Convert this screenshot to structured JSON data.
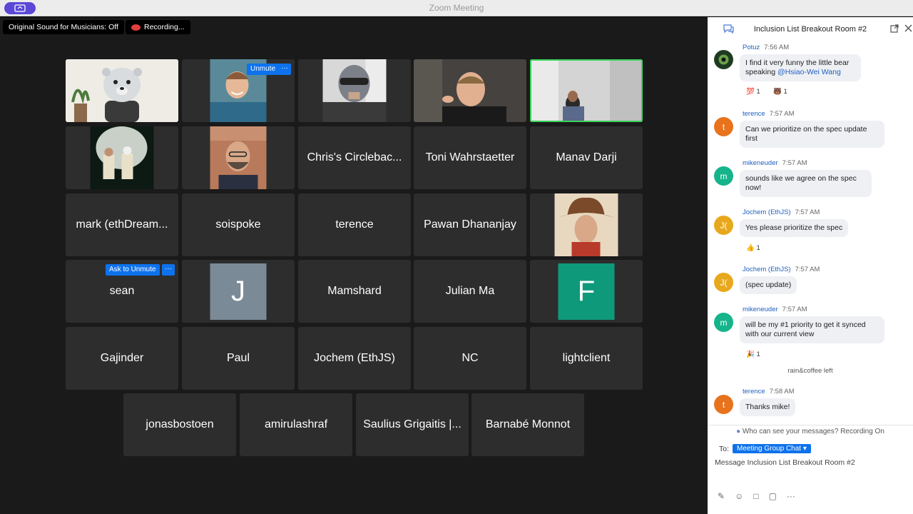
{
  "window": {
    "title": "Zoom Meeting"
  },
  "meeting": {
    "sound_badge": "Original Sound for Musicians: Off",
    "recording_badge": "Recording...",
    "unmute_label": "Unmute",
    "ask_unmute_label": "Ask to Unmute",
    "more_label": "···",
    "tiles": [
      "Chris's Circlebac...",
      "Toni Wahrstaetter",
      "Manav Darji",
      "mark (ethDream...",
      "soispoke",
      "terence",
      "Pawan Dhananjay",
      "sean",
      "Mamshard",
      "Julian Ma",
      "Gajinder",
      "Paul",
      "Jochem (EthJS)",
      "NC",
      "lightclient",
      "jonasbostoen",
      "amirulashraf",
      "Saulius Grigaitis |...",
      "Barnabé Monnot"
    ],
    "avatar_j": "J",
    "avatar_f": "F"
  },
  "chat": {
    "title": "Inclusion List Breakout Room #2",
    "messages": [
      {
        "sender": "Potuz",
        "time": "7:56 AM",
        "text": "I find it very funny the little bear speaking ",
        "mention": "@Hsiao-Wei Wang",
        "reactions": [
          "💯 1",
          "🐻 1"
        ]
      },
      {
        "sender": "terence",
        "time": "7:57 AM",
        "initial": "t",
        "text": "Can we prioritize on the spec update first"
      },
      {
        "sender": "mikeneuder",
        "time": "7:57 AM",
        "initial": "m",
        "text": "sounds like we agree on the spec now!"
      },
      {
        "sender": "Jochem (EthJS)",
        "time": "7:57 AM",
        "initial": "J(",
        "text": "Yes please prioritize the spec",
        "reactions": [
          "👍 1"
        ]
      },
      {
        "sender": "Jochem (EthJS)",
        "time": "7:57 AM",
        "initial": "J(",
        "text": "(spec update)"
      },
      {
        "sender": "mikeneuder",
        "time": "7:57 AM",
        "initial": "m",
        "text": "will be my #1 priority to get it synced with our current view",
        "reactions": [
          "🎉 1"
        ]
      },
      {
        "sender": "terence",
        "time": "7:58 AM",
        "initial": "t",
        "text": "Thanks mike!"
      }
    ],
    "system_left": "rain&coffee left",
    "visibility_notice": "Who can see your messages? Recording On",
    "to_label": "To:",
    "recipient": "Meeting Group Chat ▾",
    "compose_placeholder": "Message Inclusion List Breakout Room #2"
  },
  "colors": {
    "accent": "#0e72ed",
    "terence": "#e8731c",
    "mikeneuder": "#16b48a",
    "jochem": "#e8a81c",
    "active_border": "#3bd35a"
  }
}
